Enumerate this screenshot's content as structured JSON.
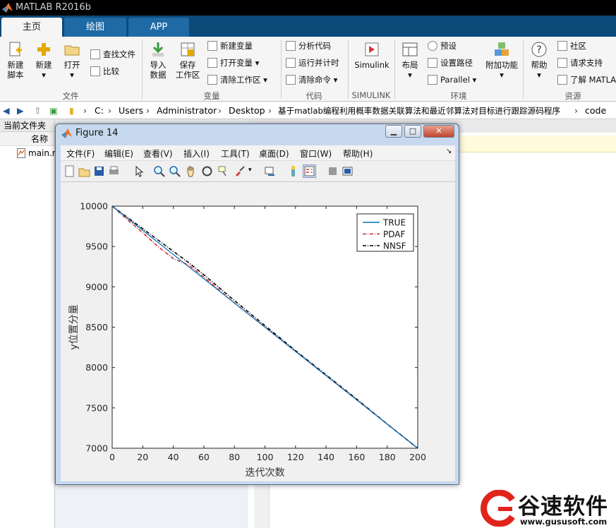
{
  "app": {
    "title": "MATLAB R2016b"
  },
  "tabs": [
    {
      "label": "主页",
      "active": true
    },
    {
      "label": "绘图",
      "active": false
    },
    {
      "label": "APP",
      "active": false
    }
  ],
  "ribbon": {
    "new_script": [
      "新建",
      "脚本"
    ],
    "new": "新建",
    "open": "打开",
    "find_files": "查找文件",
    "compare": "比较",
    "import": [
      "导入",
      "数据"
    ],
    "save_ws": [
      "保存",
      "工作区"
    ],
    "new_var": "新建变量",
    "open_var": "打开变量",
    "clear_ws": "清除工作区",
    "analyze": "分析代码",
    "run_time": "运行并计时",
    "clear_cmd": "清除命令",
    "simulink": "Simulink",
    "layout": "布局",
    "prefs": "预设",
    "set_path": "设置路径",
    "parallel": "Parallel",
    "addons": "附加功能",
    "help": "帮助",
    "community": "社区",
    "support": "请求支持",
    "learn": "了解 MATLAB",
    "sections": {
      "file": "文件",
      "var": "变量",
      "code": "代码",
      "simulink": "SIMULINK",
      "env": "环境",
      "res": "资源"
    }
  },
  "address": {
    "crumbs": [
      "C:",
      "Users",
      "Administrator",
      "Desktop",
      "基于matlab编程利用概率数据关联算法和最近邻算法对目标进行跟踪源码程序",
      "code"
    ]
  },
  "left_panel": {
    "title": "当前文件夹",
    "col_name": "名称",
    "file": "main.m"
  },
  "figure": {
    "title": "Figure 14",
    "menu": [
      "文件(F)",
      "编辑(E)",
      "查看(V)",
      "插入(I)",
      "工具(T)",
      "桌面(D)",
      "窗口(W)",
      "帮助(H)"
    ],
    "menu_arrow": "↘"
  },
  "chart_data": {
    "type": "line",
    "title": "",
    "xlabel": "迭代次数",
    "ylabel": "y位置分量",
    "xlim": [
      0,
      200
    ],
    "ylim": [
      7000,
      10000
    ],
    "xticks": [
      0,
      20,
      40,
      60,
      80,
      100,
      120,
      140,
      160,
      180,
      200
    ],
    "yticks": [
      7000,
      7500,
      8000,
      8500,
      9000,
      9500,
      10000
    ],
    "legend_position": "top-right",
    "series": [
      {
        "name": "TRUE",
        "color": "#0072bd",
        "style": "solid",
        "x": [
          0,
          200
        ],
        "y": [
          10000,
          7000
        ]
      },
      {
        "name": "PDAF",
        "color": "#d62728",
        "style": "dash-dot",
        "x": [
          0,
          10,
          20,
          30,
          40,
          45,
          50,
          60,
          70,
          80,
          100,
          120,
          140,
          160,
          180,
          200
        ],
        "y": [
          10000,
          9830,
          9670,
          9500,
          9350,
          9310,
          9270,
          9120,
          8960,
          8800,
          8500,
          8200,
          7900,
          7600,
          7300,
          7000
        ]
      },
      {
        "name": "NNSF",
        "color": "#000000",
        "style": "dash-dot",
        "x": [
          0,
          10,
          20,
          30,
          40,
          50,
          60,
          70,
          80,
          100,
          120,
          140,
          160,
          180,
          200
        ],
        "y": [
          10000,
          9860,
          9720,
          9580,
          9440,
          9300,
          9150,
          8990,
          8830,
          8520,
          8210,
          7910,
          7610,
          7300,
          7000
        ]
      }
    ]
  },
  "watermark": {
    "brand": "谷速软件",
    "url": "www.gususoft.com"
  }
}
